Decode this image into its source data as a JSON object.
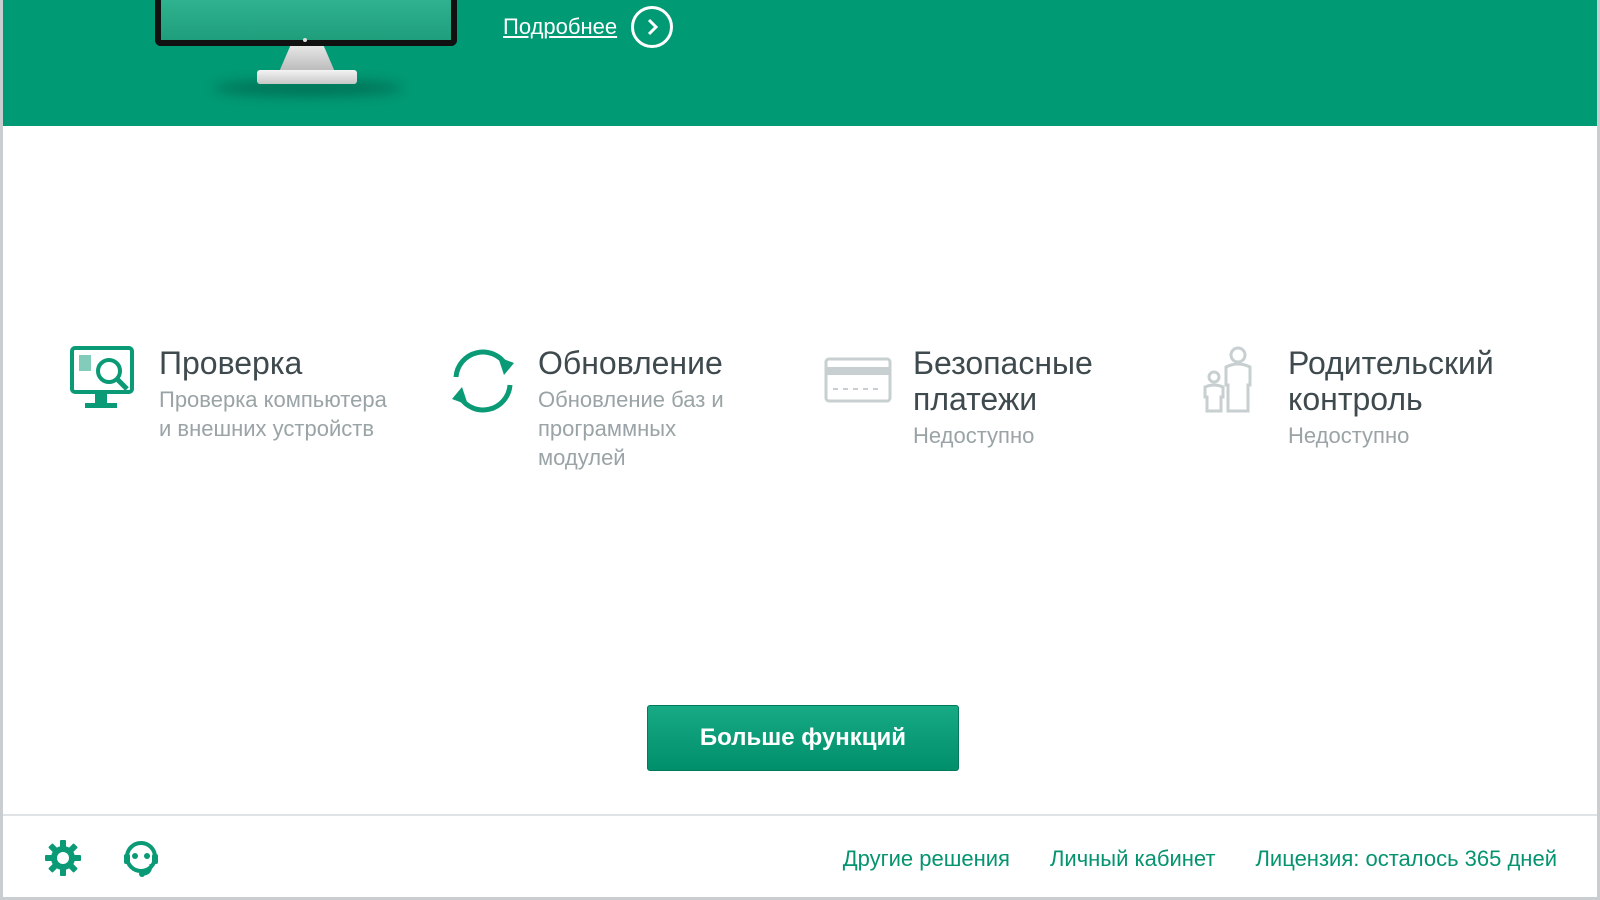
{
  "banner": {
    "more_link": "Подробнее"
  },
  "features": [
    {
      "title": "Проверка",
      "description": "Проверка компьютера и внешних устройств",
      "icon": "monitor-scan-icon"
    },
    {
      "title": "Обновление",
      "description": "Обновление баз и программных модулей",
      "icon": "refresh-icon"
    },
    {
      "title": "Безопасные платежи",
      "description": "Недоступно",
      "icon": "card-icon"
    },
    {
      "title": "Родительский контроль",
      "description": "Недоступно",
      "icon": "parent-child-icon"
    }
  ],
  "more_functions_button": "Больше функций",
  "footer": {
    "settings_icon": "gear-icon",
    "support_icon": "support-icon",
    "links": [
      "Другие решения",
      "Личный кабинет",
      "Лицензия: осталось 365 дней"
    ]
  },
  "colors": {
    "brand_green": "#009a74",
    "text_dark": "#3f4a4e",
    "text_muted": "#9aa3a6",
    "icon_disabled": "#c8cfd1"
  }
}
